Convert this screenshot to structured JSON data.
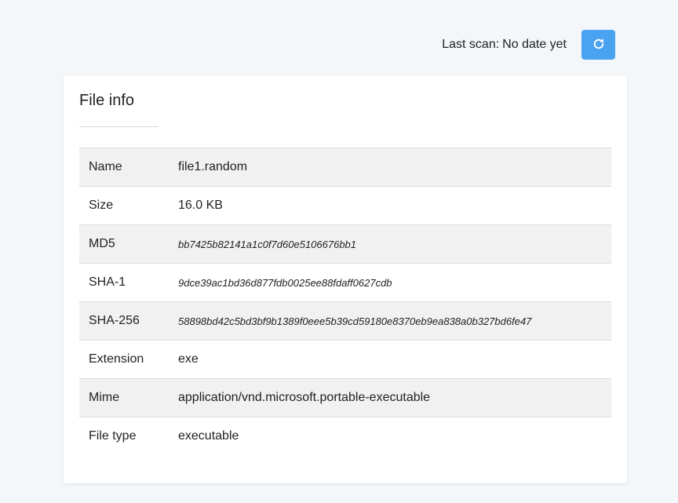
{
  "header": {
    "last_scan_label": "Last scan:",
    "last_scan_value": "No date yet",
    "refresh_icon": "refresh-icon",
    "refresh_color": "#4aa3f0"
  },
  "card": {
    "title": "File info"
  },
  "rows": [
    {
      "label": "Name",
      "value": "file1.random",
      "hash": false
    },
    {
      "label": "Size",
      "value": "16.0 KB",
      "hash": false
    },
    {
      "label": "MD5",
      "value": "bb7425b82141a1c0f7d60e5106676bb1",
      "hash": true
    },
    {
      "label": "SHA-1",
      "value": "9dce39ac1bd36d877fdb0025ee88fdaff0627cdb",
      "hash": true
    },
    {
      "label": "SHA-256",
      "value": "58898bd42c5bd3bf9b1389f0eee5b39cd59180e8370eb9ea838a0b327bd6fe47",
      "hash": true
    },
    {
      "label": "Extension",
      "value": "exe",
      "hash": false
    },
    {
      "label": "Mime",
      "value": "application/vnd.microsoft.portable-executable",
      "hash": false
    },
    {
      "label": "File type",
      "value": "executable",
      "hash": false
    }
  ]
}
